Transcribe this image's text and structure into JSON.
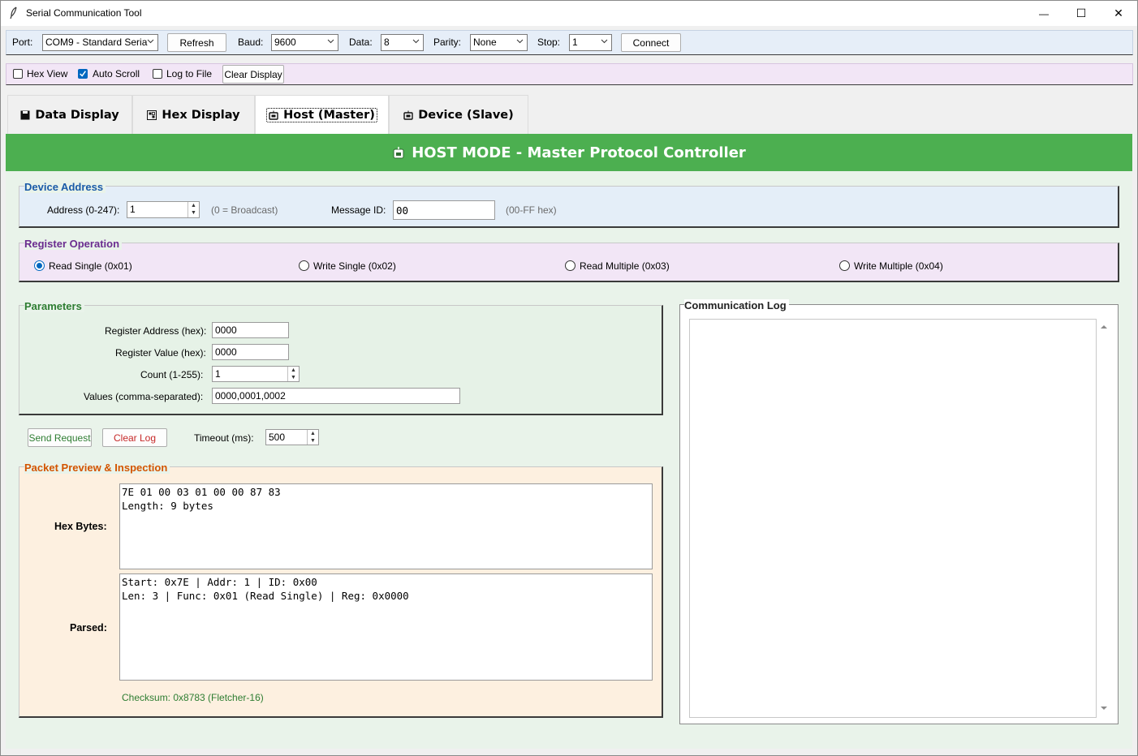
{
  "window": {
    "title": "Serial Communication Tool",
    "minimize_glyph": "—",
    "maximize_glyph": "☐",
    "close_glyph": "✕"
  },
  "toolbar": {
    "port_label": "Port:",
    "port_value": "COM9 - Standard Seria",
    "refresh_label": "Refresh",
    "baud_label": "Baud:",
    "baud_value": "9600",
    "data_label": "Data:",
    "data_value": "8",
    "parity_label": "Parity:",
    "parity_value": "None",
    "stop_label": "Stop:",
    "stop_value": "1",
    "connect_label": "Connect"
  },
  "options": {
    "hex_view_label": "Hex View",
    "hex_view_checked": false,
    "auto_scroll_label": "Auto Scroll",
    "auto_scroll_checked": true,
    "log_to_file_label": "Log to File",
    "log_to_file_checked": false,
    "clear_display_label": "Clear Display"
  },
  "tabs": [
    {
      "label": "Data Display",
      "icon": "floppy-icon",
      "active": false
    },
    {
      "label": "Hex Display",
      "icon": "hex-grid-icon",
      "active": false
    },
    {
      "label": "Host (Master)",
      "icon": "robot-icon",
      "active": true
    },
    {
      "label": "Device (Slave)",
      "icon": "robot-icon",
      "active": false
    }
  ],
  "banner": {
    "title": "HOST MODE - Master Protocol Controller",
    "icon": "robot-icon",
    "color": "#4caf50"
  },
  "device_address": {
    "title": "Device Address",
    "title_color": "#1a5aa8",
    "address_label": "Address (0-247):",
    "address_value": "1",
    "address_hint": "(0 = Broadcast)",
    "message_id_label": "Message ID:",
    "message_id_value": "00",
    "message_id_hint": "(00-FF hex)"
  },
  "register_operation": {
    "title": "Register Operation",
    "title_color": "#6a2c8f",
    "options": [
      {
        "label": "Read Single (0x01)",
        "selected": true
      },
      {
        "label": "Write Single (0x02)",
        "selected": false
      },
      {
        "label": "Read Multiple (0x03)",
        "selected": false
      },
      {
        "label": "Write Multiple (0x04)",
        "selected": false
      }
    ]
  },
  "parameters": {
    "title": "Parameters",
    "title_color": "#2e7d32",
    "register_address_label": "Register Address (hex):",
    "register_address_value": "0000",
    "register_value_label": "Register Value (hex):",
    "register_value_value": "0000",
    "count_label": "Count (1-255):",
    "count_value": "1",
    "values_label": "Values (comma-separated):",
    "values_value": "0000,0001,0002"
  },
  "actions": {
    "send_request_label": "Send Request",
    "send_request_color": "#2e7d32",
    "clear_log_label": "Clear Log",
    "clear_log_color": "#c62828",
    "timeout_label": "Timeout (ms):",
    "timeout_value": "500"
  },
  "packet_preview": {
    "title": "Packet Preview & Inspection",
    "title_color": "#d35400",
    "hex_bytes_label": "Hex Bytes:",
    "hex_bytes_text": "7E 01 00 03 01 00 00 87 83\nLength: 9 bytes",
    "parsed_label": "Parsed:",
    "parsed_text": "Start: 0x7E | Addr: 1 | ID: 0x00\nLen: 3 | Func: 0x01 (Read Single) | Reg: 0x0000",
    "checksum_text": "Checksum: 0x8783 (Fletcher-16)",
    "checksum_color": "#2e7d32"
  },
  "communication_log": {
    "title": "Communication Log",
    "content": ""
  }
}
